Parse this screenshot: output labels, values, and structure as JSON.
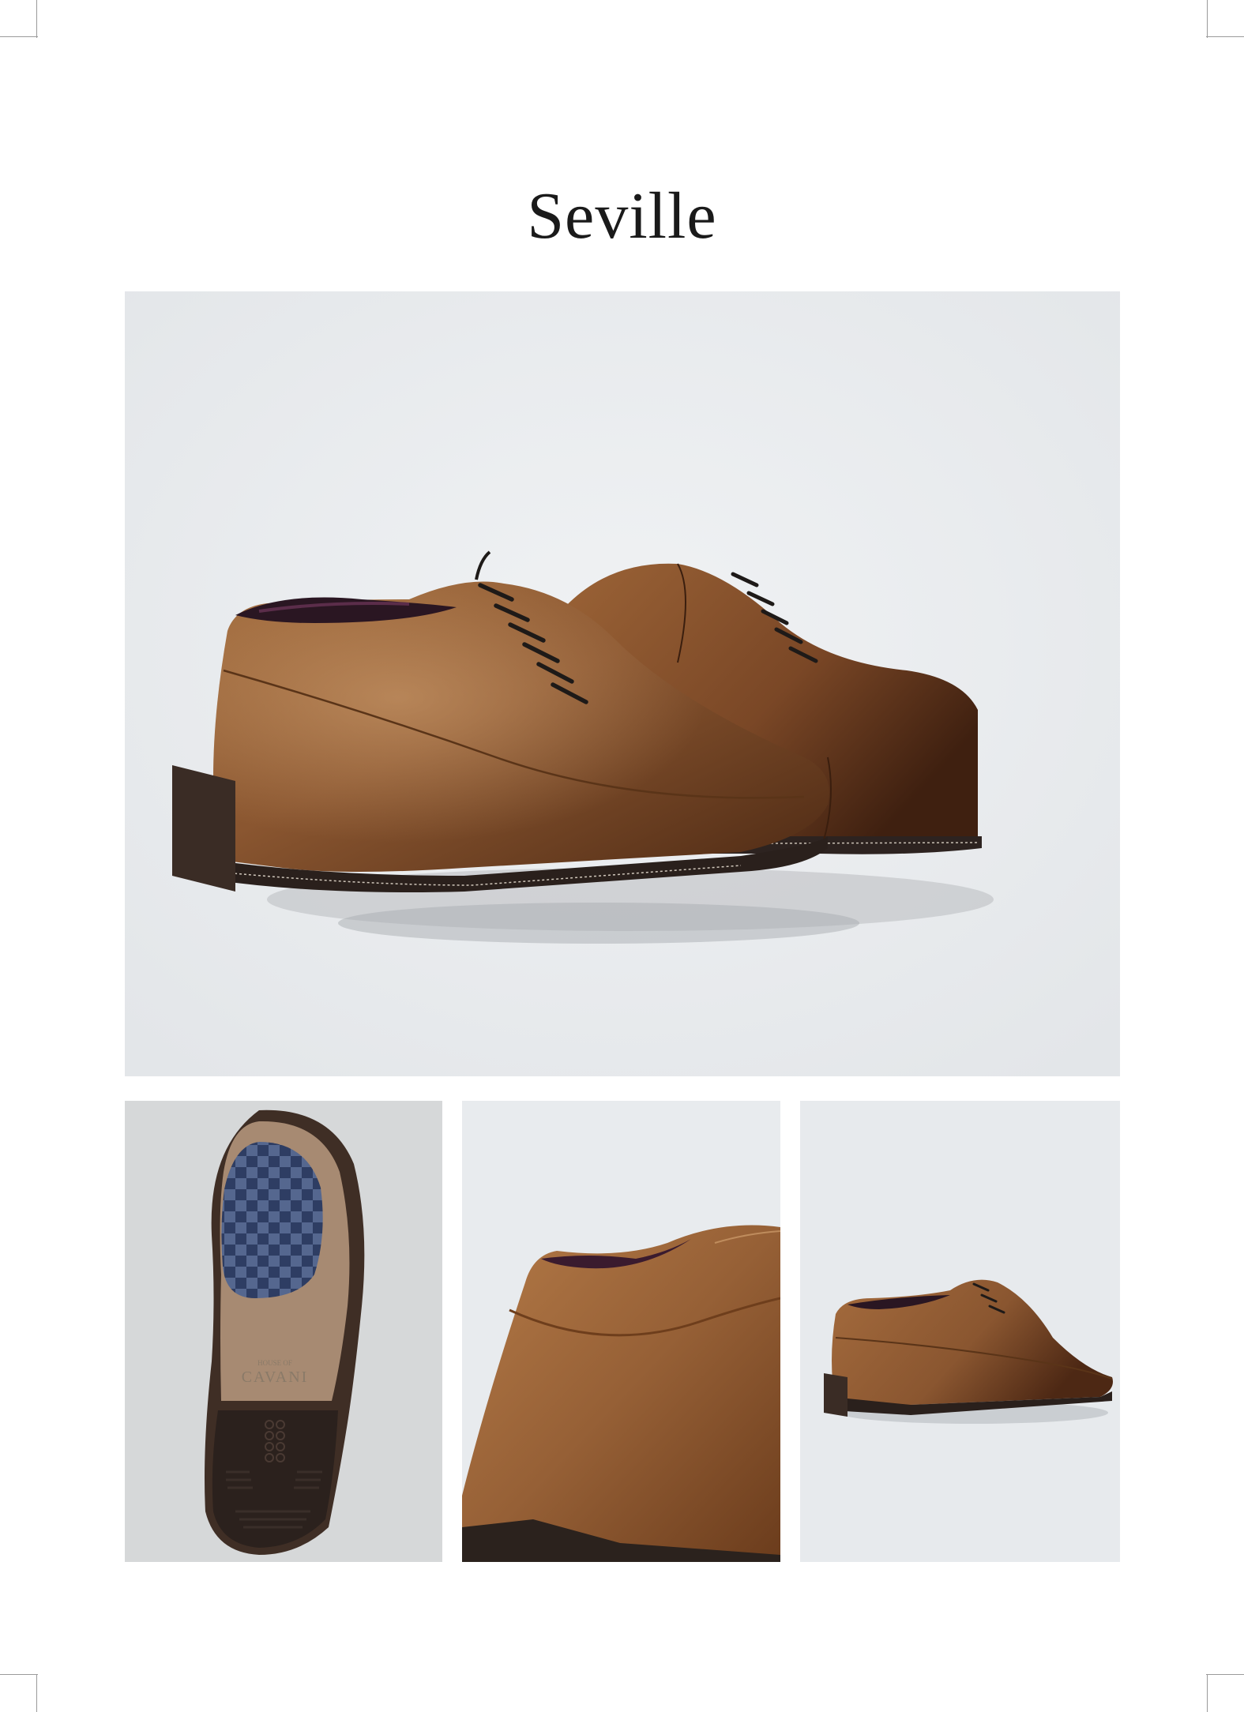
{
  "page": {
    "title": "Seville"
  },
  "photos": {
    "hero": {
      "subject": "pair-of-tan-leather-oxford-shoes"
    },
    "sole": {
      "subject": "shoe-sole-bottom-view",
      "brand_top": "HOUSE OF",
      "brand": "CAVANI"
    },
    "heel": {
      "subject": "heel-close-up"
    },
    "side": {
      "subject": "single-shoe-side-view"
    }
  },
  "colors": {
    "leather": "#8b5a32",
    "leather_dark": "#5a3418",
    "sole": "#3b2d26",
    "insole_blue": "#3d4f7a",
    "background": "#e9ecee"
  }
}
